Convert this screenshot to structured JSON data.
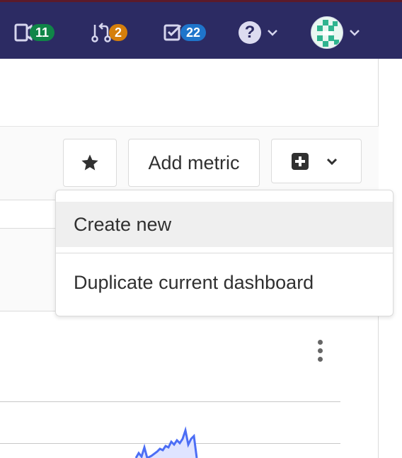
{
  "topbar": {
    "issues_count": "11",
    "merge_requests_count": "2",
    "todos_count": "22",
    "colors": {
      "background": "#2c2b63",
      "issues_badge": "#108548",
      "mr_badge": "#d57f0c",
      "todos_badge": "#1f75cb"
    }
  },
  "toolbar": {
    "star_icon": "star-icon",
    "add_metric_label": "Add metric",
    "new_dashboard_icon": "plus-square-icon"
  },
  "dropdown": {
    "items": [
      {
        "label": "Create new"
      },
      {
        "label": "Duplicate current dashboard"
      }
    ]
  }
}
